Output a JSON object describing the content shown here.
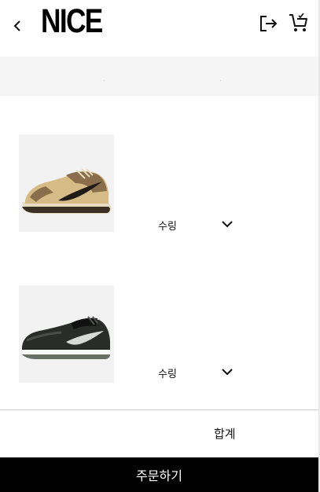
{
  "header": {
    "logo": "NICE",
    "back_icon": "chevron-left-icon",
    "logout_icon": "logout-icon",
    "cart_icon": "cart-icon"
  },
  "cart": {
    "items": [
      {
        "image": "product-image",
        "quantity_label": "수링",
        "dropdown_icon": "chevron-down-icon"
      },
      {
        "image": "product-image",
        "quantity_label": "수링",
        "dropdown_icon": "chevron-down-icon"
      }
    ]
  },
  "summary": {
    "total_label": "합계"
  },
  "order_button": {
    "label": "주문하기"
  },
  "colors": {
    "primary": "#000000",
    "banner": "#f5f5f5",
    "background": "#ffffff"
  }
}
